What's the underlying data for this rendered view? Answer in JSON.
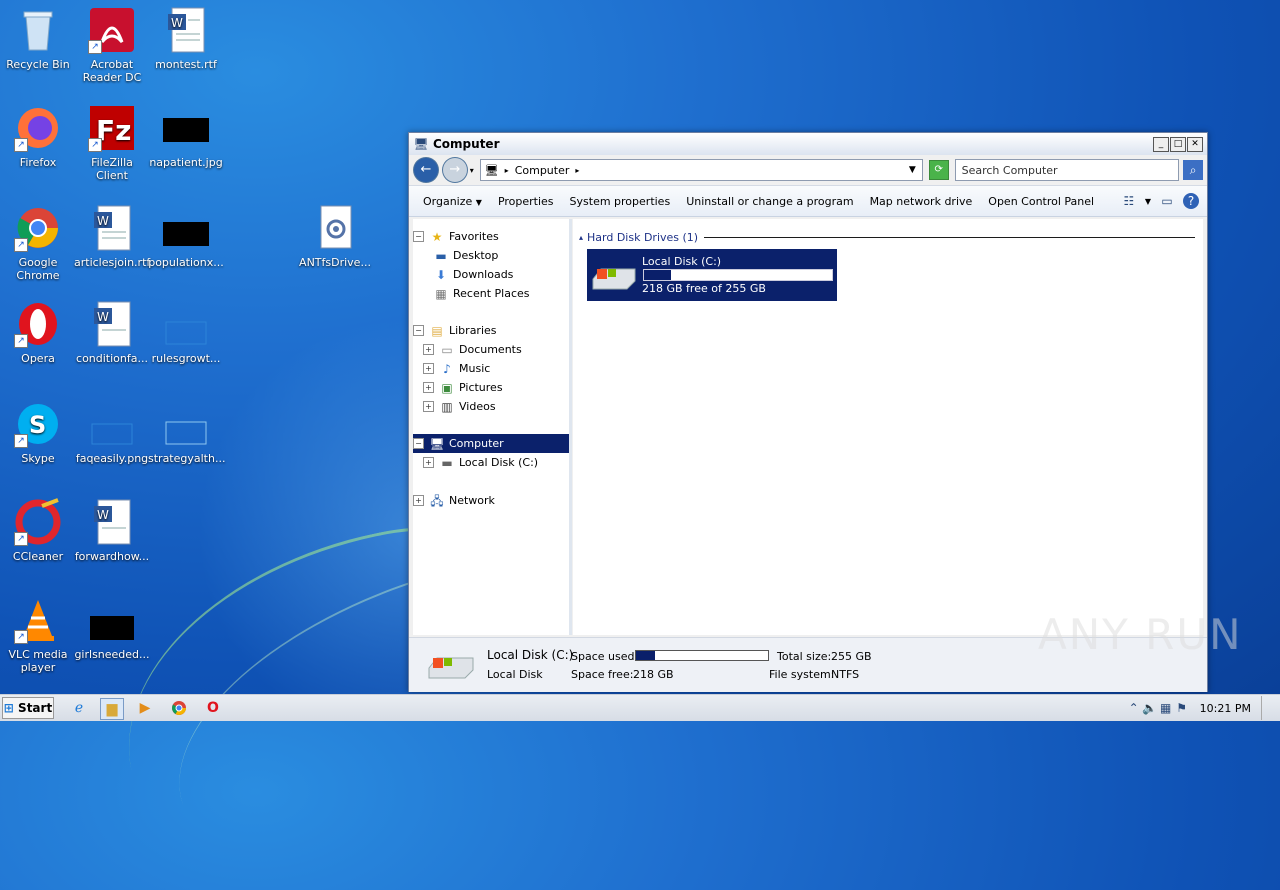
{
  "desktop": {
    "icons": [
      {
        "label": "Recycle Bin"
      },
      {
        "label": "Acrobat Reader DC"
      },
      {
        "label": "montest.rtf"
      },
      {
        "label": "Firefox"
      },
      {
        "label": "FileZilla Client"
      },
      {
        "label": "napatient.jpg"
      },
      {
        "label": "Google Chrome"
      },
      {
        "label": "articlesjoin.rtf"
      },
      {
        "label": "populationx..."
      },
      {
        "label": "ANTfsDrive..."
      },
      {
        "label": "Opera"
      },
      {
        "label": "conditionfa..."
      },
      {
        "label": "rulesgrowt..."
      },
      {
        "label": "Skype"
      },
      {
        "label": "faqeasily.png"
      },
      {
        "label": "strategyalth..."
      },
      {
        "label": "CCleaner"
      },
      {
        "label": "forwardhow..."
      },
      {
        "label": "VLC media player"
      },
      {
        "label": "girlsneeded..."
      }
    ]
  },
  "window": {
    "title": "Computer",
    "address": "Computer",
    "search_placeholder": "Search Computer",
    "commands": [
      "Organize",
      "Properties",
      "System properties",
      "Uninstall or change a program",
      "Map network drive",
      "Open Control Panel"
    ],
    "nav": {
      "favorites": "Favorites",
      "desktop": "Desktop",
      "downloads": "Downloads",
      "recent": "Recent Places",
      "libraries": "Libraries",
      "documents": "Documents",
      "music": "Music",
      "pictures": "Pictures",
      "videos": "Videos",
      "computer": "Computer",
      "localdisk": "Local Disk (C:)",
      "network": "Network"
    },
    "group_header": "Hard Disk Drives (1)",
    "drive": {
      "name": "Local Disk (C:)",
      "free_text": "218 GB free of 255 GB",
      "used_fraction": 0.145
    },
    "details": {
      "name": "Local Disk (C:)",
      "type": "Local Disk",
      "space_used_label": "Space used:",
      "space_free_label": "Space free:",
      "space_free_value": "218 GB",
      "total_size_label": "Total size:",
      "total_size_value": "255 GB",
      "fs_label": "File system:",
      "fs_value": "NTFS"
    }
  },
  "taskbar": {
    "start": "Start",
    "clock": "10:21 PM"
  },
  "watermark": "ANY RUN",
  "colors": {
    "selection": "#0b216b",
    "desktop_bg": "#1f6fcf"
  }
}
